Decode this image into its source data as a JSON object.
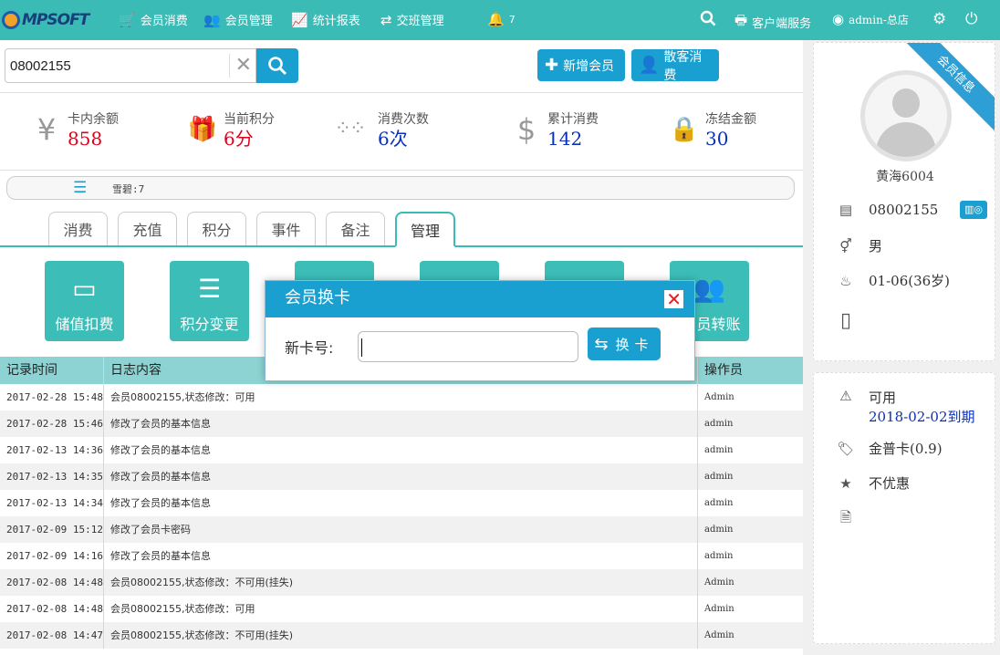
{
  "app": {
    "logo_text": "MPSOFT"
  },
  "nav": {
    "items": [
      {
        "label": "会员消费",
        "icon": "cart-icon"
      },
      {
        "label": "会员管理",
        "icon": "users-icon"
      },
      {
        "label": "统计报表",
        "icon": "chart-icon"
      },
      {
        "label": "交班管理",
        "icon": "exchange-icon"
      }
    ],
    "bell_count": "7",
    "client_service_label": "客户端服务",
    "user_label": "admin-总店"
  },
  "search": {
    "value": "08002155"
  },
  "actions": {
    "add_member": "新增会员",
    "walkin": "散客消费"
  },
  "stats": [
    {
      "label": "卡内余额",
      "value": "858",
      "color": "#e0001b"
    },
    {
      "label": "当前积分",
      "value": "6分",
      "color": "#e0001b"
    },
    {
      "label": "消费次数",
      "value": "6次",
      "color": "#0a2fb8"
    },
    {
      "label": "累计消费",
      "value": "142",
      "color": "#0a2fb8"
    },
    {
      "label": "冻结金额",
      "value": "30",
      "color": "#0a2fb8"
    }
  ],
  "tagbar": {
    "tag": "雪碧:7"
  },
  "tabs": [
    "消费",
    "充值",
    "积分",
    "事件",
    "备注",
    "管理"
  ],
  "active_tab": "管理",
  "tiles": [
    {
      "label": "储值扣费"
    },
    {
      "label": "积分变更"
    },
    {
      "label": ""
    },
    {
      "label": ""
    },
    {
      "label": ""
    },
    {
      "label": "员转账"
    }
  ],
  "log_table": {
    "headers": [
      "记录时间",
      "日志内容",
      "操作员"
    ],
    "rows": [
      [
        "2017-02-28 15:48",
        "会员08002155,状态修改：可用",
        "Admin"
      ],
      [
        "2017-02-28 15:46",
        "修改了会员的基本信息",
        "admin"
      ],
      [
        "2017-02-13 14:36",
        "修改了会员的基本信息",
        "admin"
      ],
      [
        "2017-02-13 14:35",
        "修改了会员的基本信息",
        "admin"
      ],
      [
        "2017-02-13 14:34",
        "修改了会员的基本信息",
        "admin"
      ],
      [
        "2017-02-09 15:12",
        "修改了会员卡密码",
        "admin"
      ],
      [
        "2017-02-09 14:16",
        "修改了会员的基本信息",
        "admin"
      ],
      [
        "2017-02-08 14:48",
        "会员08002155,状态修改：不可用(挂失)",
        "Admin"
      ],
      [
        "2017-02-08 14:48",
        "会员08002155,状态修改：可用",
        "Admin"
      ],
      [
        "2017-02-08 14:47",
        "会员08002155,状态修改：不可用(挂失)",
        "Admin"
      ]
    ]
  },
  "member": {
    "ribbon": "会员信息",
    "name": "黄海6004",
    "card_no": "08002155",
    "gender": "男",
    "birthday": "01-06(36岁)",
    "status": "可用",
    "expiry": "2018-02-02到期",
    "card_type": "金普卡(0.9)",
    "discount": "不优惠"
  },
  "modal": {
    "title": "会员换卡",
    "field_label": "新卡号:",
    "button_label": "换卡",
    "input_value": ""
  }
}
